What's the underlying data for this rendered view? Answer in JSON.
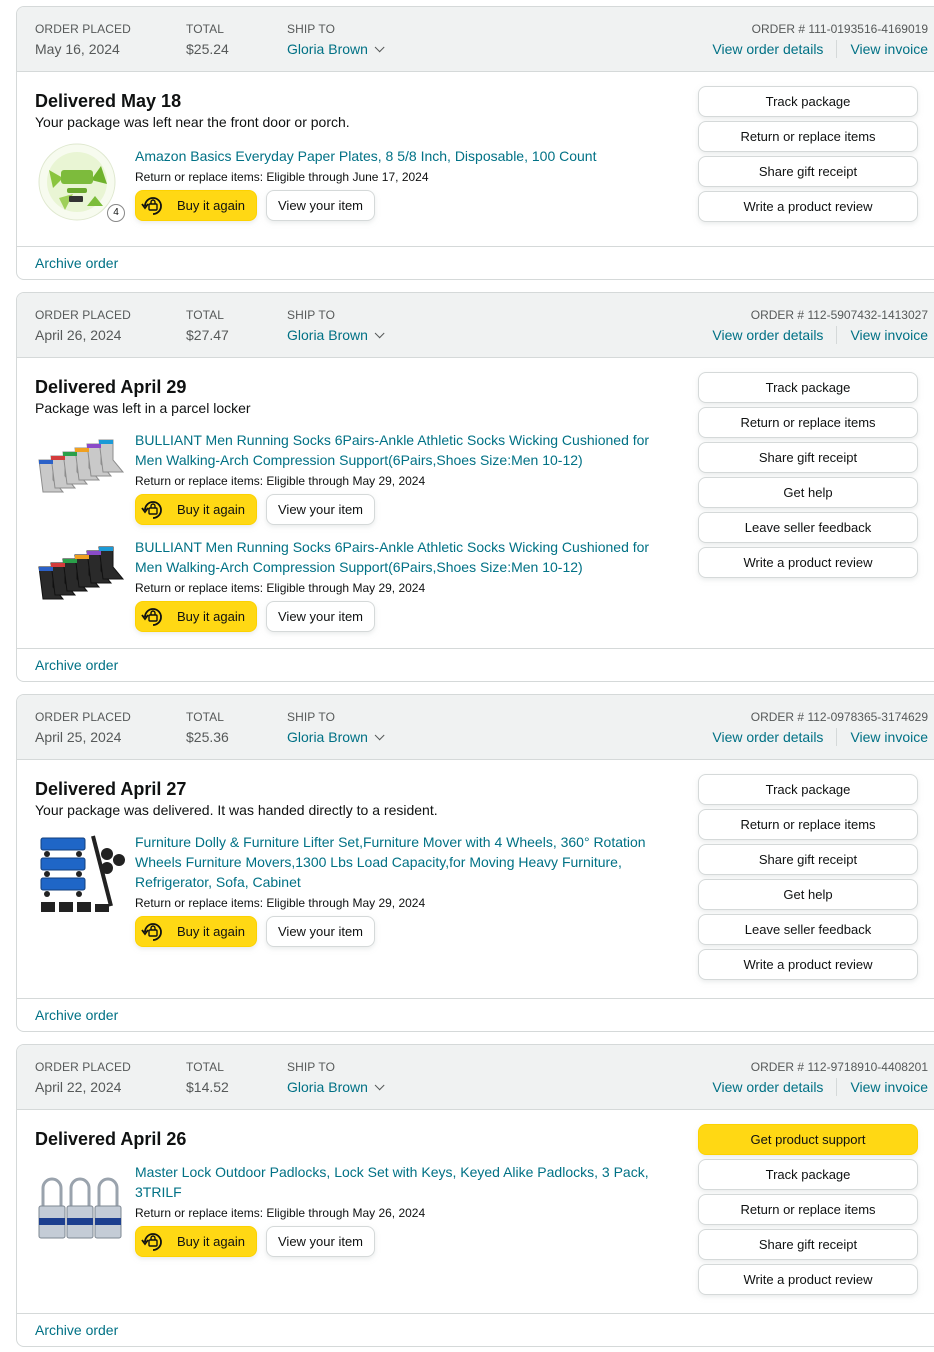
{
  "labels": {
    "order_placed": "ORDER PLACED",
    "total": "TOTAL",
    "ship_to": "SHIP TO",
    "view_order_details": "View order details",
    "view_invoice": "View invoice",
    "buy_it_again": "Buy it again",
    "view_your_item": "View your item",
    "archive_order": "Archive order"
  },
  "orders": [
    {
      "date": "May 16, 2024",
      "total": "$25.24",
      "ship_to": "Gloria Brown",
      "order_number": "ORDER # 111-0193516-4169019",
      "status": "Delivered May 18",
      "note": "Your package was left near the front door or porch.",
      "items": [
        {
          "title": "Amazon Basics Everyday Paper Plates, 8 5/8 Inch, Disposable, 100 Count",
          "return": "Return or replace items: Eligible through June 17, 2024",
          "quantity": "4",
          "image": "paper-plates"
        }
      ],
      "actions": [
        "Track package",
        "Return or replace items",
        "Share gift receipt",
        "Write a product review"
      ]
    },
    {
      "date": "April 26, 2024",
      "total": "$27.47",
      "ship_to": "Gloria Brown",
      "order_number": "ORDER # 112-5907432-1413027",
      "status": "Delivered April 29",
      "note": "Package was left in a parcel locker",
      "items": [
        {
          "title": "BULLIANT Men Running Socks 6Pairs-Ankle Athletic Socks Wicking Cushioned for Men Walking-Arch Compression Support(6Pairs,Shoes Size:Men 10-12)",
          "return": "Return or replace items: Eligible through May 29, 2024",
          "image": "socks-grey"
        },
        {
          "title": "BULLIANT Men Running Socks 6Pairs-Ankle Athletic Socks Wicking Cushioned for Men Walking-Arch Compression Support(6Pairs,Shoes Size:Men 10-12)",
          "return": "Return or replace items: Eligible through May 29, 2024",
          "image": "socks-black"
        }
      ],
      "actions": [
        "Track package",
        "Return or replace items",
        "Share gift receipt",
        "Get help",
        "Leave seller feedback",
        "Write a product review"
      ]
    },
    {
      "date": "April 25, 2024",
      "total": "$25.36",
      "ship_to": "Gloria Brown",
      "order_number": "ORDER # 112-0978365-3174629",
      "status": "Delivered April 27",
      "note": "Your package was delivered. It was handed directly to a resident.",
      "items": [
        {
          "title": "Furniture Dolly & Furniture Lifter Set,Furniture Mover with 4 Wheels, 360° Rotation Wheels Furniture Movers,1300 Lbs Load Capacity,for Moving Heavy Furniture, Refrigerator, Sofa, Cabinet",
          "return": "Return or replace items: Eligible through May 29, 2024",
          "image": "furniture-dolly"
        }
      ],
      "actions": [
        "Track package",
        "Return or replace items",
        "Share gift receipt",
        "Get help",
        "Leave seller feedback",
        "Write a product review"
      ]
    },
    {
      "date": "April 22, 2024",
      "total": "$14.52",
      "ship_to": "Gloria Brown",
      "order_number": "ORDER # 112-9718910-4408201",
      "status": "Delivered April 26",
      "note": "",
      "primary_action": "Get product support",
      "items": [
        {
          "title": "Master Lock Outdoor Padlocks, Lock Set with Keys, Keyed Alike Padlocks, 3 Pack, 3TRILF",
          "return": "Return or replace items: Eligible through May 26, 2024",
          "image": "padlocks"
        }
      ],
      "actions": [
        "Track package",
        "Return or replace items",
        "Share gift receipt",
        "Write a product review"
      ]
    }
  ],
  "colors": {
    "link": "#007185",
    "header_bg": "#f0f2f2",
    "border": "#d5d9d9",
    "primary_button": "#ffd814",
    "text": "#0f1111",
    "muted": "#565959"
  }
}
